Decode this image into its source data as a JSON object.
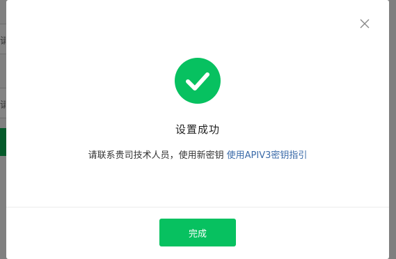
{
  "background": {
    "row1_text": "请",
    "row2_text": "请"
  },
  "dialog": {
    "title": "设置成功",
    "description": "请联系贵司技术人员，使用新密钥",
    "guide_link": "使用APIV3密钥指引",
    "done_button": "完成",
    "icons": {
      "close": "close-icon",
      "success": "success-check-icon"
    },
    "colors": {
      "primary": "#07c160",
      "link": "#3a6aa8"
    }
  }
}
